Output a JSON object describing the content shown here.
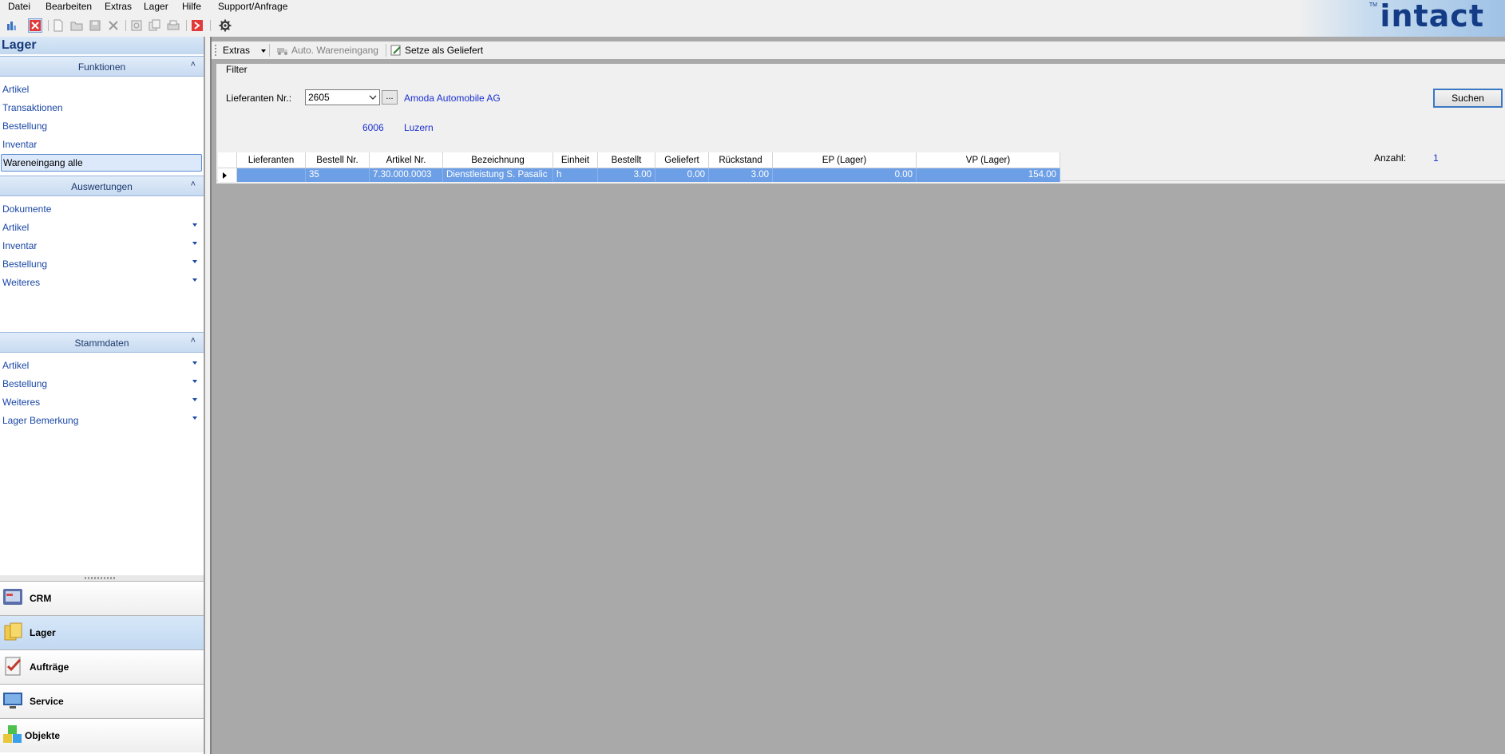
{
  "menu": [
    "Datei",
    "Bearbeiten",
    "Extras",
    "Lager",
    "Hilfe",
    "Support/Anfrage"
  ],
  "brand": {
    "logo": "intact",
    "tm": "TM"
  },
  "toolbar_icons": [
    "bar-chart-icon",
    "close-red-icon",
    "new-doc-icon",
    "open-folder-icon",
    "save-icon",
    "delete-icon",
    "preview-icon",
    "copy-icon",
    "print-icon",
    "exit-icon",
    "gear-icon"
  ],
  "left": {
    "title": "Lager",
    "funktionen": {
      "title": "Funktionen",
      "items": [
        "Artikel",
        "Transaktionen",
        "Bestellung",
        "Inventar",
        "Wareneingang alle"
      ],
      "selected": "Wareneingang alle"
    },
    "auswertungen": {
      "title": "Auswertungen",
      "items": [
        "Dokumente",
        "Artikel",
        "Inventar",
        "Bestellung",
        "Weiteres"
      ]
    },
    "stammdaten": {
      "title": "Stammdaten",
      "items": [
        "Artikel",
        "Bestellung",
        "Weiteres",
        "Lager Bemerkung"
      ]
    },
    "modules": [
      "CRM",
      "Lager",
      "Aufträge",
      "Service",
      "Objekte"
    ],
    "active_module": "Lager"
  },
  "main": {
    "toolbar": {
      "extras": "Extras",
      "auto": "Auto. Wareneingang",
      "setze": "Setze als Geliefert"
    },
    "filter": {
      "title": "Filter",
      "supplier_label": "Lieferanten Nr.:",
      "supplier_value": "2605",
      "browse": "...",
      "supplier_name": "Amoda Automobile AG",
      "zip": "6006",
      "city": "Luzern",
      "search_button": "Suchen",
      "count_label": "Anzahl:",
      "count_value": "1"
    },
    "grid": {
      "columns": [
        "Lieferanten",
        "Bestell Nr.",
        "Artikel Nr.",
        "Bezeichnung",
        "Einheit",
        "Bestellt",
        "Geliefert",
        "Rückstand",
        "EP (Lager)",
        "VP (Lager)"
      ],
      "rows": [
        [
          "",
          "35",
          "7.30.000.0003",
          "Dienstleistung S. Pasalic",
          "h",
          "3.00",
          "0.00",
          "3.00",
          "0.00",
          "154.00"
        ]
      ]
    }
  },
  "colors": {
    "accent": "#1a47a6",
    "selection": "#6d9fe6",
    "header": "#c8dbf1"
  }
}
